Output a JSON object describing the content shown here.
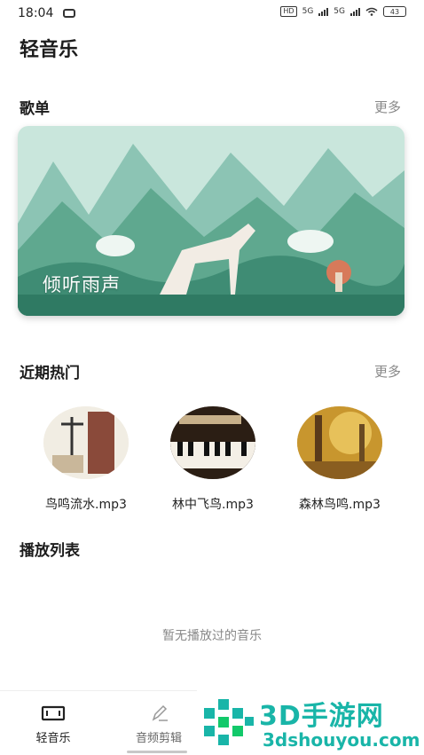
{
  "status": {
    "time": "18:04",
    "hd": "HD",
    "net1": "5G",
    "net2": "5G",
    "battery": "43"
  },
  "app": {
    "title": "轻音乐"
  },
  "playlist_section": {
    "title": "歌单",
    "more": "更多",
    "banner_caption": "倾听雨声"
  },
  "hot_section": {
    "title": "近期热门",
    "more": "更多",
    "items": [
      {
        "name": "鸟鸣流水.mp3"
      },
      {
        "name": "林中飞鸟.mp3"
      },
      {
        "name": "森林鸟鸣.mp3"
      }
    ]
  },
  "play_list": {
    "title": "播放列表",
    "empty_text": "暂无播放过的音乐"
  },
  "bottom_nav": {
    "items": [
      {
        "label": "轻音乐",
        "icon": "music-frame-icon"
      },
      {
        "label": "音频剪辑",
        "icon": "pen-icon"
      }
    ]
  },
  "watermark": {
    "title": "3D手游网",
    "url": "3dshouyou.com"
  },
  "colors": {
    "brand": "#19b5a8",
    "banner_bg": "#b9ddd1",
    "muted": "#888888"
  }
}
